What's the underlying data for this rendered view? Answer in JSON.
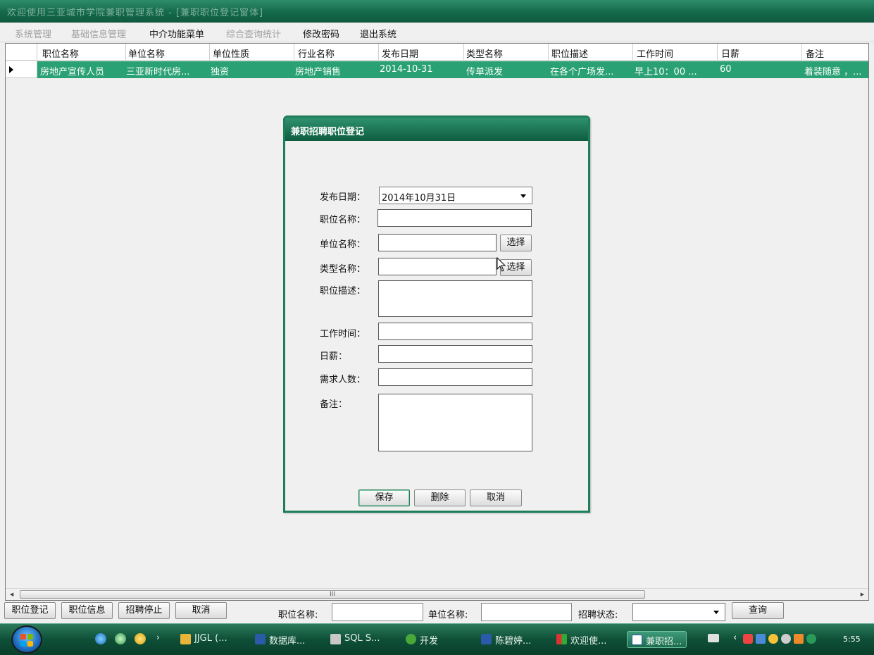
{
  "window": {
    "title": "欢迎使用三亚城市学院兼职管理系统 - [兼职职位登记窗体]"
  },
  "menu": [
    "系统管理",
    "基础信息管理",
    "中介功能菜单",
    "综合查询统计",
    "修改密码",
    "退出系统"
  ],
  "grid": {
    "columns": [
      "职位名称",
      "单位名称",
      "单位性质",
      "行业名称",
      "发布日期",
      "类型名称",
      "职位描述",
      "工作时间",
      "日薪",
      "备注"
    ],
    "rows": [
      [
        "房地产宣传人员",
        "三亚新时代房...",
        "独资",
        "房地产销售",
        "2014-10-31",
        "传单派发",
        "在各个广场发...",
        "早上10：00 ...",
        "60",
        "着装随意 ，..."
      ]
    ],
    "hscroll_grip": "III"
  },
  "dialog": {
    "title": "兼职招聘职位登记",
    "fields": {
      "date": {
        "label": "发布日期：",
        "value": "2014年10月31日"
      },
      "job_name": {
        "label": "职位名称：",
        "value": ""
      },
      "company": {
        "label": "单位名称：",
        "value": "",
        "button": "选择"
      },
      "type": {
        "label": "类型名称：",
        "value": "",
        "button": "选择"
      },
      "description": {
        "label": "职位描述：",
        "value": ""
      },
      "work_time": {
        "label": "工作时间：",
        "value": ""
      },
      "salary": {
        "label": "日薪：",
        "value": ""
      },
      "headcount": {
        "label": "需求人数：",
        "value": ""
      },
      "remark": {
        "label": "备注：",
        "value": ""
      }
    },
    "buttons": {
      "save": "保存",
      "delete": "删除",
      "cancel": "取消"
    }
  },
  "bottombar": {
    "buttons": [
      "职位登记",
      "职位信息",
      "招聘停止",
      "取消"
    ],
    "filter_job_label": "职位名称:",
    "filter_job_value": "",
    "filter_company_label": "单位名称:",
    "filter_company_value": "",
    "filter_status_label": "招聘状态:",
    "filter_status_value": "",
    "query_button": "查询"
  },
  "taskbar": {
    "items": [
      {
        "label": "JJGL (...",
        "icon": "folder-icon"
      },
      {
        "label": "数据库...",
        "icon": "word-doc-icon"
      },
      {
        "label": "SQL S...",
        "icon": "sql-server-icon"
      },
      {
        "label": "开发",
        "icon": "tree-icon"
      },
      {
        "label": "陈碧婷...",
        "icon": "word-doc-icon"
      },
      {
        "label": "欢迎使...",
        "icon": "app-window-icon"
      },
      {
        "label": "兼职招...",
        "icon": "form-window-icon",
        "active": true
      }
    ],
    "clock": "5:55"
  },
  "colors": {
    "accent": "#1e7e5a",
    "selected_row": "#2aa175",
    "taskbar": "#0e4f37"
  }
}
